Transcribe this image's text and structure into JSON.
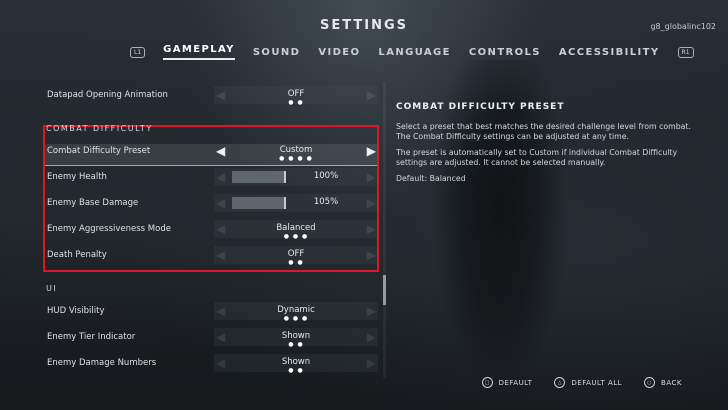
{
  "header": {
    "title": "SETTINGS",
    "user": "g8_globalinc102",
    "left_bumper": "L1",
    "right_bumper": "R1",
    "tabs": [
      "GAMEPLAY",
      "SOUND",
      "VIDEO",
      "LANGUAGE",
      "CONTROLS",
      "ACCESSIBILITY"
    ],
    "active_tab": "GAMEPLAY"
  },
  "settings": {
    "datapad": {
      "label": "Datapad Opening Animation",
      "value": "OFF"
    },
    "combat_section": "COMBAT DIFFICULTY",
    "preset": {
      "label": "Combat Difficulty Preset",
      "value": "Custom"
    },
    "enemy_health": {
      "label": "Enemy Health",
      "value": "100%",
      "level": 1.0
    },
    "enemy_damage": {
      "label": "Enemy Base Damage",
      "value": "105%",
      "level": 1.0
    },
    "aggressiveness": {
      "label": "Enemy Aggressiveness Mode",
      "value": "Balanced"
    },
    "death_penalty": {
      "label": "Death Penalty",
      "value": "OFF"
    },
    "ui_section": "UI",
    "hud": {
      "label": "HUD Visibility",
      "value": "Dynamic"
    },
    "tier": {
      "label": "Enemy Tier Indicator",
      "value": "Shown"
    },
    "damage_numbers": {
      "label": "Enemy Damage Numbers",
      "value": "Shown"
    }
  },
  "description": {
    "title": "COMBAT DIFFICULTY PRESET",
    "p1": "Select a preset that best matches the desired challenge level from combat. The Combat Difficulty settings can be adjusted at any time.",
    "p2": "The preset is automatically set to Custom if individual Combat Difficulty settings are adjusted. It cannot be selected manually.",
    "p3": "Default: Balanced"
  },
  "footer": {
    "default": "DEFAULT",
    "default_all": "DEFAULT ALL",
    "back": "BACK"
  },
  "colors": {
    "highlight_box": "#e01628",
    "text": "#d8dde2"
  }
}
